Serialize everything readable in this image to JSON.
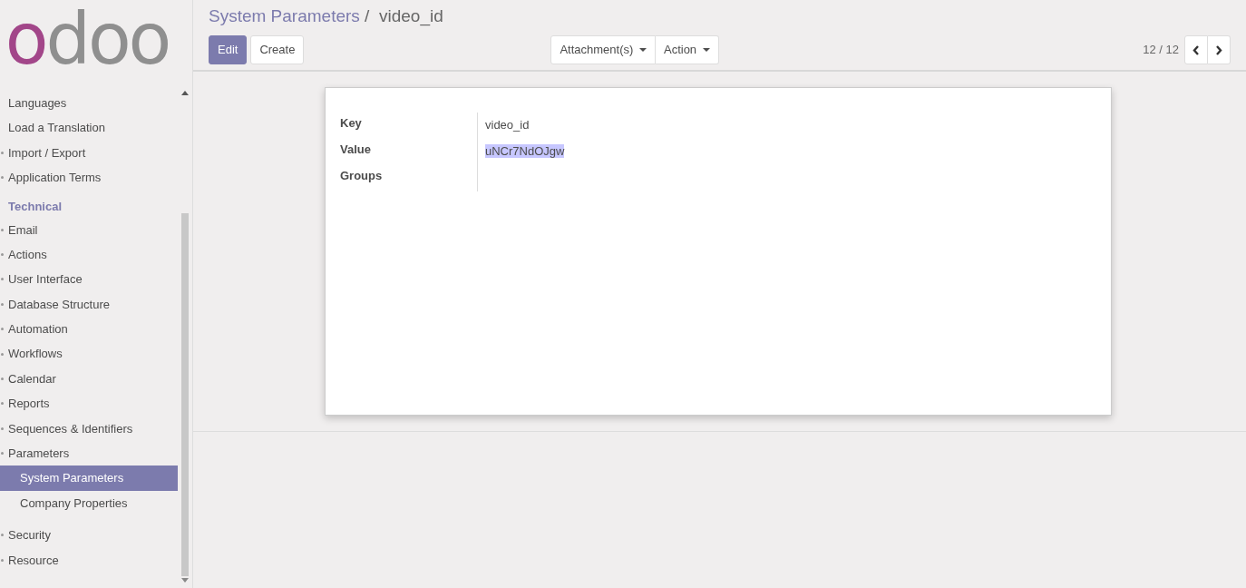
{
  "logo": {
    "text": "odoo"
  },
  "sidebar": {
    "items": [
      {
        "kind": "subitem",
        "label": "Languages",
        "selected": false
      },
      {
        "kind": "subitem",
        "label": "Load a Translation",
        "selected": false
      },
      {
        "kind": "item",
        "label": "Import / Export",
        "selected": false
      },
      {
        "kind": "item",
        "label": "Application Terms",
        "selected": false
      },
      {
        "kind": "section",
        "label": "Technical"
      },
      {
        "kind": "item",
        "label": "Email",
        "selected": false
      },
      {
        "kind": "item",
        "label": "Actions",
        "selected": false
      },
      {
        "kind": "item",
        "label": "User Interface",
        "selected": false
      },
      {
        "kind": "item",
        "label": "Database Structure",
        "selected": false
      },
      {
        "kind": "item",
        "label": "Automation",
        "selected": false
      },
      {
        "kind": "item",
        "label": "Workflows",
        "selected": false
      },
      {
        "kind": "item",
        "label": "Calendar",
        "selected": false
      },
      {
        "kind": "item",
        "label": "Reports",
        "selected": false
      },
      {
        "kind": "item",
        "label": "Sequences & Identifiers",
        "selected": false
      },
      {
        "kind": "item",
        "label": "Parameters",
        "selected": false,
        "children": [
          {
            "label": "System Parameters",
            "selected": true
          },
          {
            "label": "Company Properties",
            "selected": false
          }
        ]
      },
      {
        "kind": "item",
        "label": "Security",
        "selected": false
      },
      {
        "kind": "item",
        "label": "Resource",
        "selected": false
      }
    ]
  },
  "breadcrumb_separator": "/",
  "breadcrumb": [
    {
      "label": "System Parameters",
      "link": true
    },
    {
      "label": "video_id",
      "link": false
    }
  ],
  "buttons": [
    {
      "label": "Edit",
      "primary": true
    },
    {
      "label": "Create",
      "primary": false
    }
  ],
  "dropdowns": [
    "Attachment(s)",
    "Action"
  ],
  "pager": {
    "text": "12 / 12"
  },
  "form": {
    "fields": [
      {
        "label": "Key",
        "value": "video_id",
        "highlighted": false
      },
      {
        "label": "Value",
        "value": "uNCr7NdOJgw",
        "highlighted": true
      },
      {
        "label": "Groups"
      }
    ]
  }
}
